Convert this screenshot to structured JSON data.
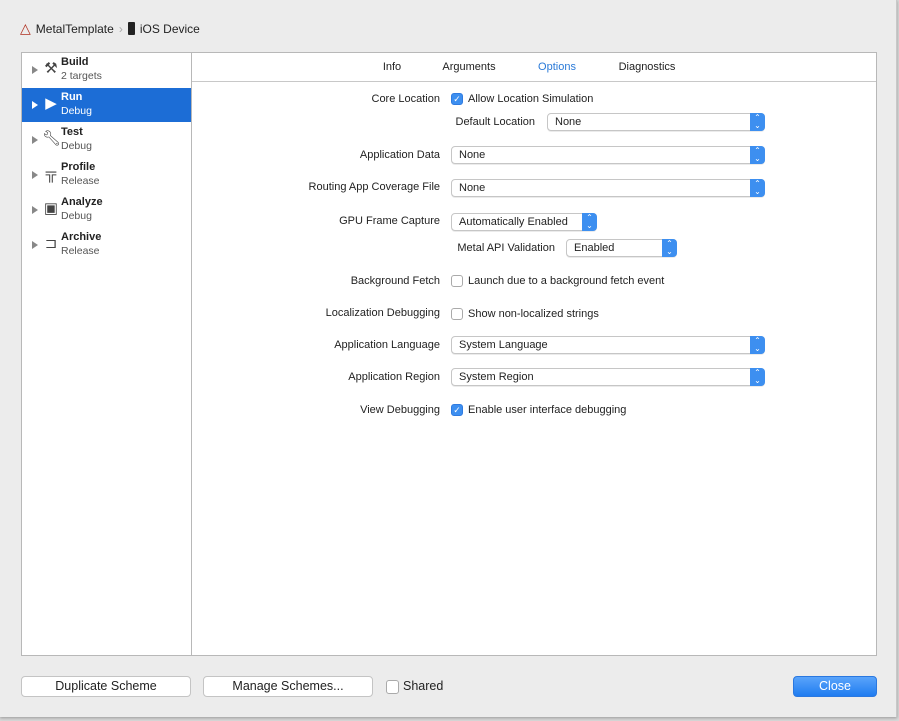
{
  "breadcrumb": {
    "project": "MetalTemplate",
    "device": "iOS Device"
  },
  "sidebar": {
    "items": [
      {
        "title": "Build",
        "subtitle": "2 targets",
        "icon": "hammer-icon",
        "selected": false
      },
      {
        "title": "Run",
        "subtitle": "Debug",
        "icon": "play-icon",
        "selected": true
      },
      {
        "title": "Test",
        "subtitle": "Debug",
        "icon": "wrench-icon",
        "selected": false
      },
      {
        "title": "Profile",
        "subtitle": "Release",
        "icon": "instruments-icon",
        "selected": false
      },
      {
        "title": "Analyze",
        "subtitle": "Debug",
        "icon": "analyze-icon",
        "selected": false
      },
      {
        "title": "Archive",
        "subtitle": "Release",
        "icon": "archive-icon",
        "selected": false
      }
    ]
  },
  "tabs": [
    "Info",
    "Arguments",
    "Options",
    "Diagnostics"
  ],
  "active_tab": "Options",
  "options": {
    "core_location": {
      "label": "Core Location",
      "checkbox": "Allow Location Simulation",
      "checked": true
    },
    "default_location": {
      "label": "Default Location",
      "value": "None"
    },
    "application_data": {
      "label": "Application Data",
      "value": "None"
    },
    "routing": {
      "label": "Routing App Coverage File",
      "value": "None"
    },
    "gpu_frame_capture": {
      "label": "GPU Frame Capture",
      "value": "Automatically Enabled"
    },
    "metal_api": {
      "label": "Metal API Validation",
      "value": "Enabled"
    },
    "background_fetch": {
      "label": "Background Fetch",
      "checkbox": "Launch due to a background fetch event",
      "checked": false
    },
    "localization": {
      "label": "Localization Debugging",
      "checkbox": "Show non-localized strings",
      "checked": false
    },
    "app_language": {
      "label": "Application Language",
      "value": "System Language"
    },
    "app_region": {
      "label": "Application Region",
      "value": "System Region"
    },
    "view_debugging": {
      "label": "View Debugging",
      "checkbox": "Enable user interface debugging",
      "checked": true
    }
  },
  "footer": {
    "duplicate": "Duplicate Scheme",
    "manage": "Manage Schemes...",
    "shared": "Shared",
    "shared_checked": false,
    "close": "Close"
  },
  "colors": {
    "selection": "#1c6dd6",
    "accent": "#3d8ff0"
  }
}
